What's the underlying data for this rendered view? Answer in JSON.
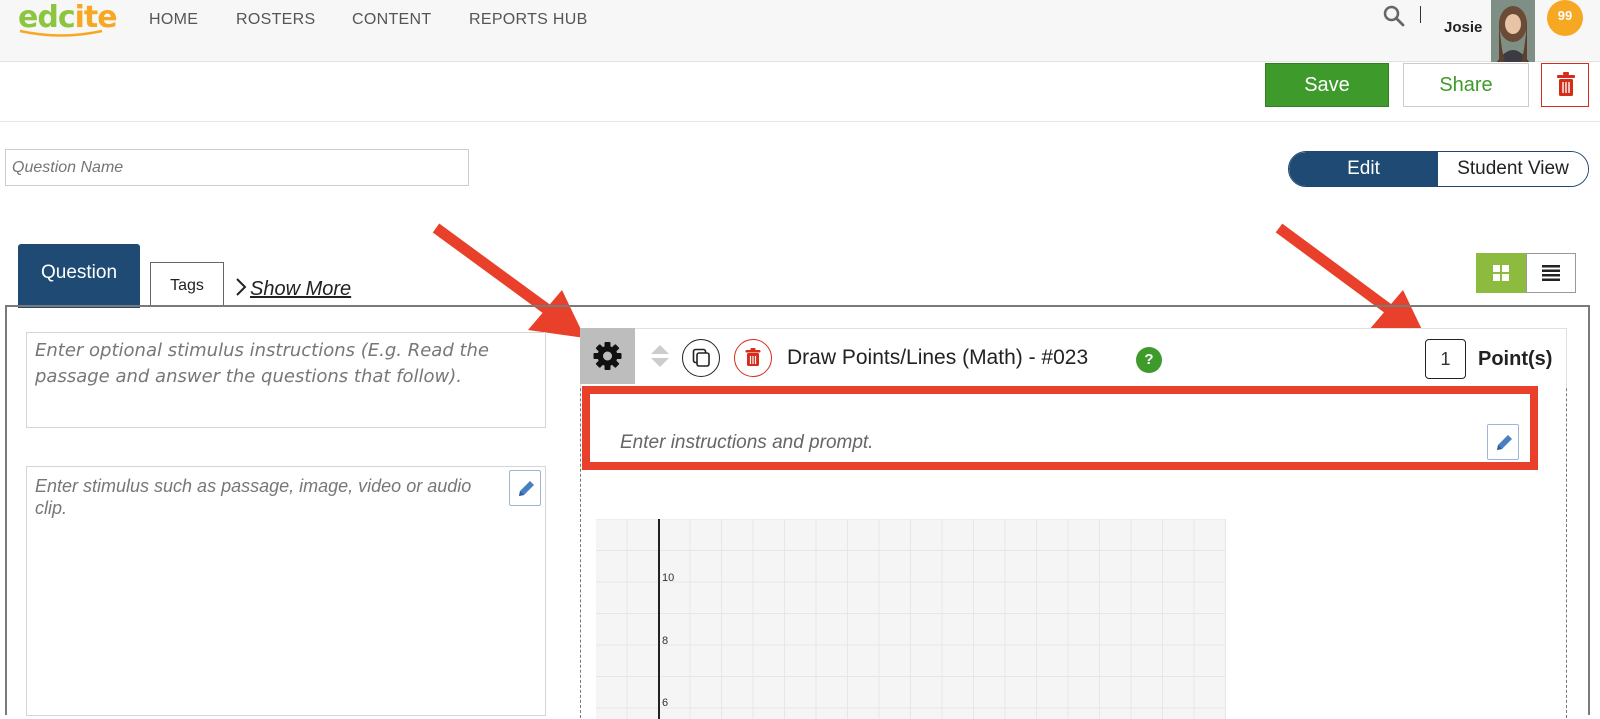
{
  "nav": {
    "logo": {
      "part1": "edc",
      "part2": "ite"
    },
    "links": [
      "HOME",
      "ROSTERS",
      "CONTENT",
      "REPORTS HUB"
    ],
    "user_name": "Josie",
    "badge_count": "99"
  },
  "toolbar": {
    "save_label": "Save",
    "share_label": "Share"
  },
  "question_name": {
    "placeholder": "Question Name",
    "value": ""
  },
  "view_toggle": {
    "edit_label": "Edit",
    "student_label": "Student View",
    "active": "Edit"
  },
  "tabs": {
    "question_label": "Question",
    "tags_label": "Tags",
    "show_more_label": "Show More"
  },
  "stimulus": {
    "instructions_placeholder": "Enter optional stimulus instructions (E.g. Read the passage and answer the questions that follow).",
    "body_placeholder": "Enter stimulus such as passage, image, video or audio clip."
  },
  "question": {
    "title": "Draw Points/Lines (Math) - #023",
    "points_value": "1",
    "points_label": "Point(s)",
    "prompt_placeholder": "Enter instructions and prompt."
  },
  "graph": {
    "y_tick_labels": [
      "10",
      "8",
      "6"
    ]
  },
  "colors": {
    "brand_green": "#3f9a2c",
    "brand_navy": "#1e4a73",
    "logo_green": "#8cc63f",
    "logo_orange": "#f7a823",
    "annotation_red": "#e8402a",
    "danger_red": "#d62c1a"
  }
}
